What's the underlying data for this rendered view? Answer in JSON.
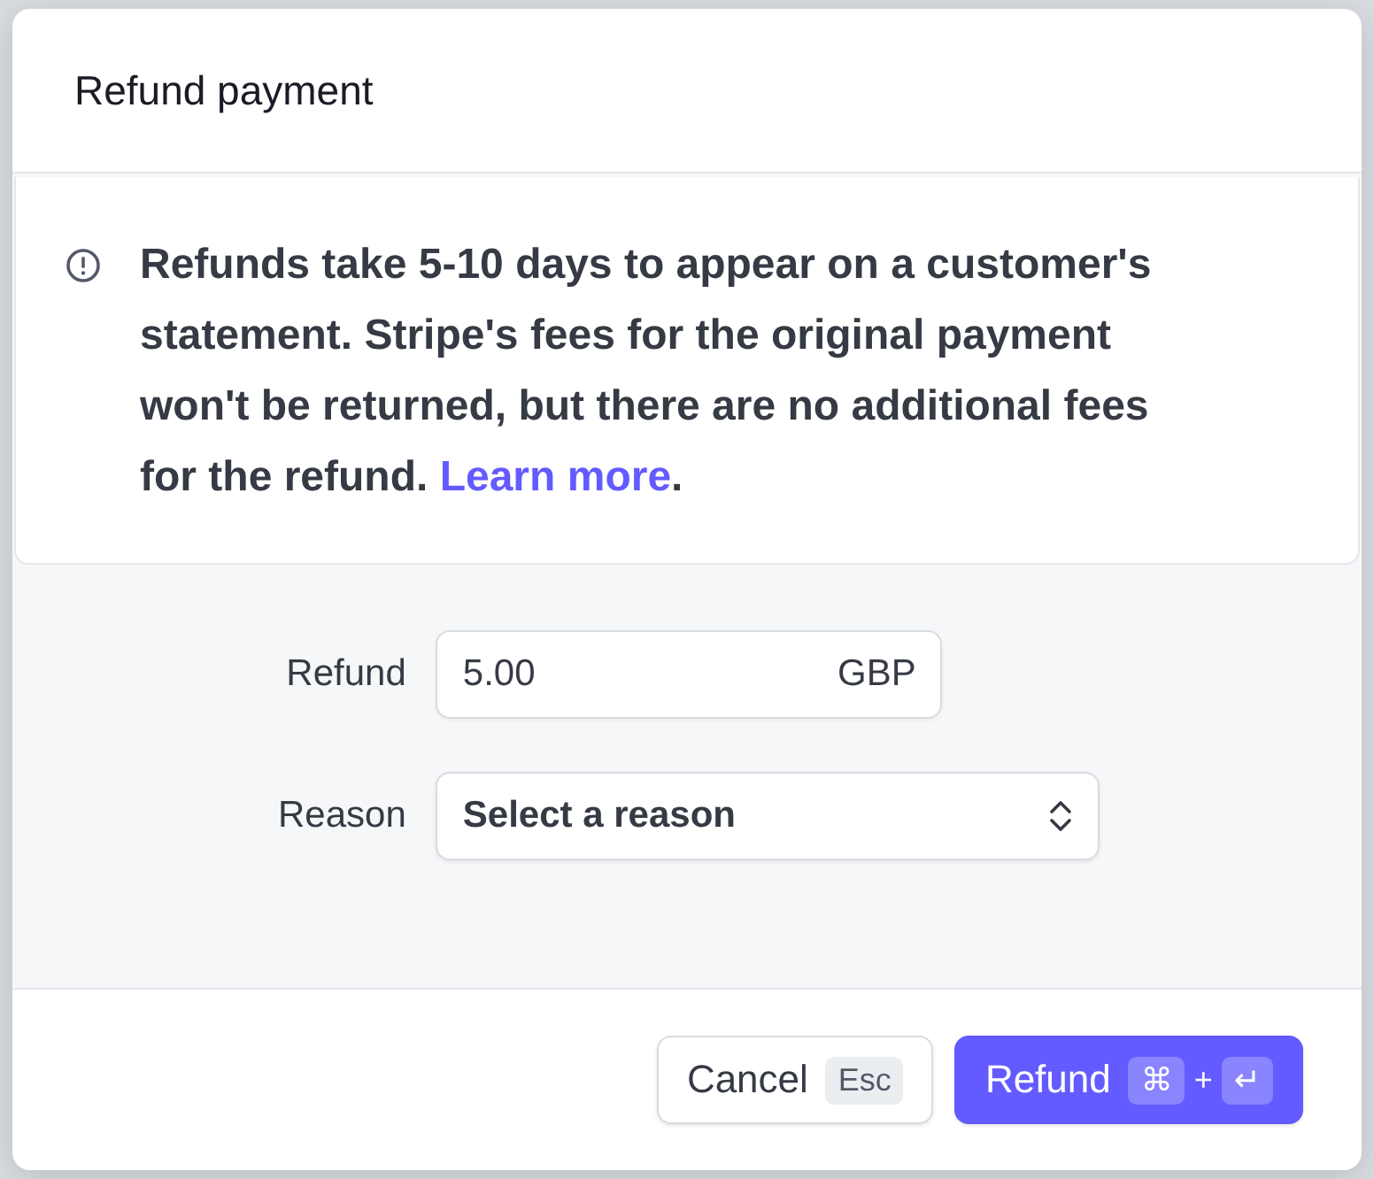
{
  "dialog": {
    "title": "Refund payment"
  },
  "notice": {
    "text": "Refunds take 5-10 days to appear on a customer's statement. Stripe's fees for the original payment won't be returned, but there are no additional fees for the refund.",
    "link": "Learn more",
    "end": "."
  },
  "form": {
    "refund": {
      "label": "Refund",
      "value": "5.00",
      "currency": "GBP"
    },
    "reason": {
      "label": "Reason",
      "placeholder": "Select a reason"
    }
  },
  "buttons": [
    {
      "kind": "secondary",
      "label": "Cancel",
      "keys": [
        "Esc"
      ]
    },
    {
      "kind": "primary",
      "label": "Refund",
      "keys": [
        "⌘",
        "+",
        "↵"
      ]
    }
  ]
}
